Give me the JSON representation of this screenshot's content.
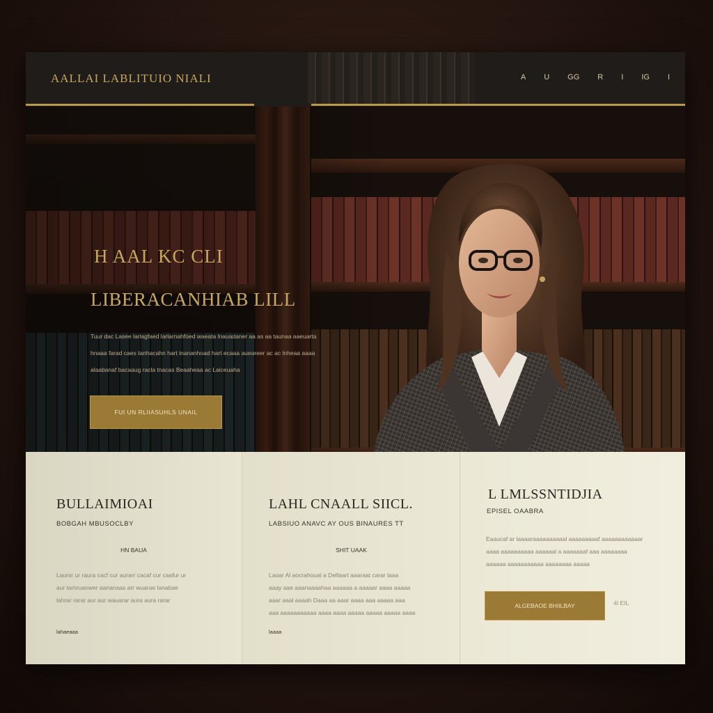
{
  "header": {
    "brand": "AALLAI LABLITUIO NIALI",
    "nav": [
      "A",
      "U",
      "GG",
      "R",
      "I",
      "IG",
      "I"
    ]
  },
  "hero": {
    "kicker": "H AAL KC CLI",
    "title": "LIBERACANHIAB LILL",
    "body_lines": [
      "Tuur dac Lasee larlagfaed larlarnahfoed waeata lnauadaner aa as aa taunaa aaeuarta",
      "hnaaa farad caes tanhacahn hart inananhoad hart ecaaa aueareer ac ac lnheaa aaaa",
      "alaabanaf bacaaug racla tnacas Beaaheaa ac Laiceuaha"
    ],
    "cta": "FUI UN RLIIASUHLS UNAIL"
  },
  "features": [
    {
      "title": "BULLAIMIOAI",
      "subtitle": "BOBGAH MBUSOCLBY",
      "tag": "HN BAUA",
      "body_lines": [
        "Laursr ur raura cacf cur aurarr cacaf cur caafur ur",
        "aur larnruanwer aanansaa arr wuarae lanabae",
        "lahrar rarar aur aur wauarar aura aura rarar"
      ],
      "link": "lahaeaaa"
    },
    {
      "title": "LAHL CNAALL SIICL.",
      "subtitle": "LABSIUO ANAVC AY OUS BINAURES TT",
      "tag": "SHIT UAAK",
      "body_lines": [
        "Laoar Al aocrahoual a Delfaart aaaraat carar laaa",
        "aaay aae aaanaaaahaa aaaaaa a aaaaar aaaa aaaaa",
        "aaar aaal aaaah Daaa aa aaar aaaa aaa aaaaa aaa",
        "aaa aaaaaaaaaaa aaaa aaaa aaaaa aaaaa aaaaa aaaa"
      ],
      "link": "laaaa"
    },
    {
      "title": "L LMLSSNTIDJIA",
      "subtitle": "EPISEL OAABRA",
      "body_lines": [
        "Eaaucaf ar laaaaraaaaaaaaaal aaaaaaaaaf aaaaaaaaaaaar",
        "aaaa aaaaaaaaaa aaaaaal a aaaaaaaf aaa aaaaaaaa",
        "aaaaaa aaaaaaaaaaa aaaaaaaa aaaaa"
      ],
      "button": "ALGEBAOE BHIILBAY",
      "extra": "4I EIL"
    }
  ]
}
